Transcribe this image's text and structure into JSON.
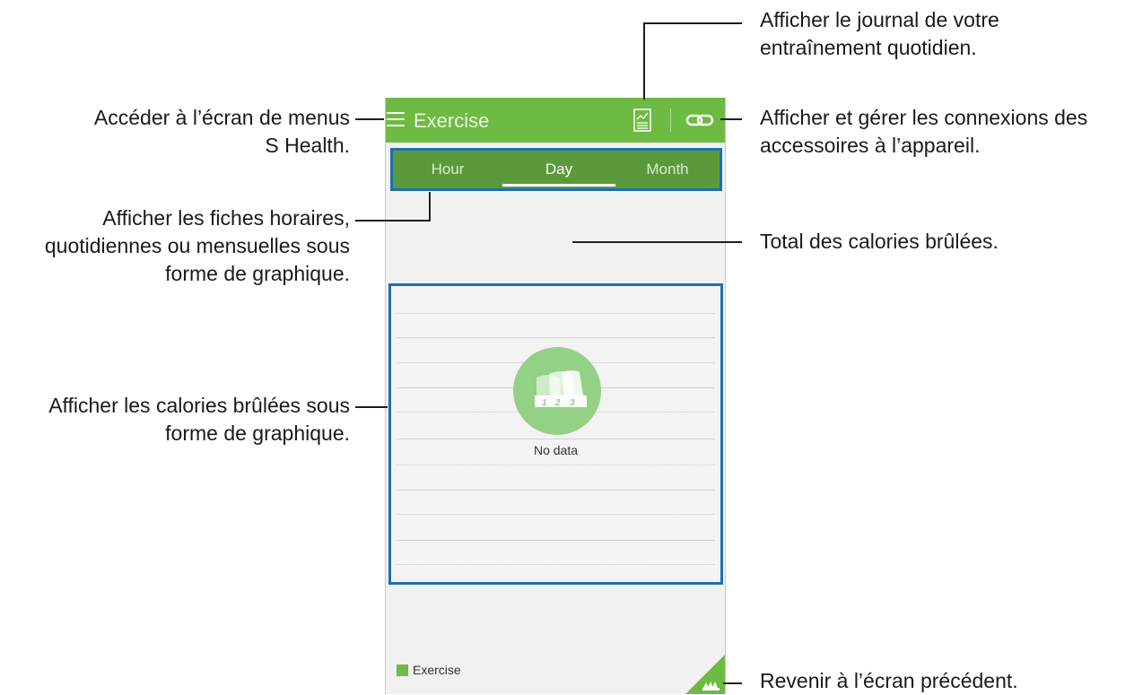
{
  "app": {
    "title": "Exercise",
    "accent_color": "#6dbb43",
    "tab_bar_color": "#5b9a3b",
    "highlight_color": "#1f6fad"
  },
  "action_bar": {
    "menu_icon": "hamburger-icon",
    "log_icon": "daily-log-icon",
    "accessory_icon": "link-icon"
  },
  "tabs": [
    {
      "label": "Hour",
      "active": false
    },
    {
      "label": "Day",
      "active": true
    },
    {
      "label": "Month",
      "active": false
    }
  ],
  "graph": {
    "empty_icon": "exercise-ranking-icon",
    "empty_text": "No data"
  },
  "legend": {
    "label": "Exercise"
  },
  "corner_button": {
    "icon": "exercise-ranking-icon"
  },
  "annotations": {
    "daily_log": [
      "Afficher le journal de votre",
      "entraînement quotidien."
    ],
    "menu": [
      "Accéder à l’écran de menus",
      "S Health."
    ],
    "accessories": [
      "Afficher et gérer les connexions des",
      "accessoires à l’appareil."
    ],
    "tabs": [
      "Afficher les fiches horaires,",
      "quotidiennes ou mensuelles sous",
      "forme de graphique."
    ],
    "total": [
      "Total des calories brûlées."
    ],
    "graph": [
      "Afficher les calories brûlées sous",
      "forme de graphique."
    ],
    "back": [
      "Revenir à l’écran précédent."
    ]
  }
}
